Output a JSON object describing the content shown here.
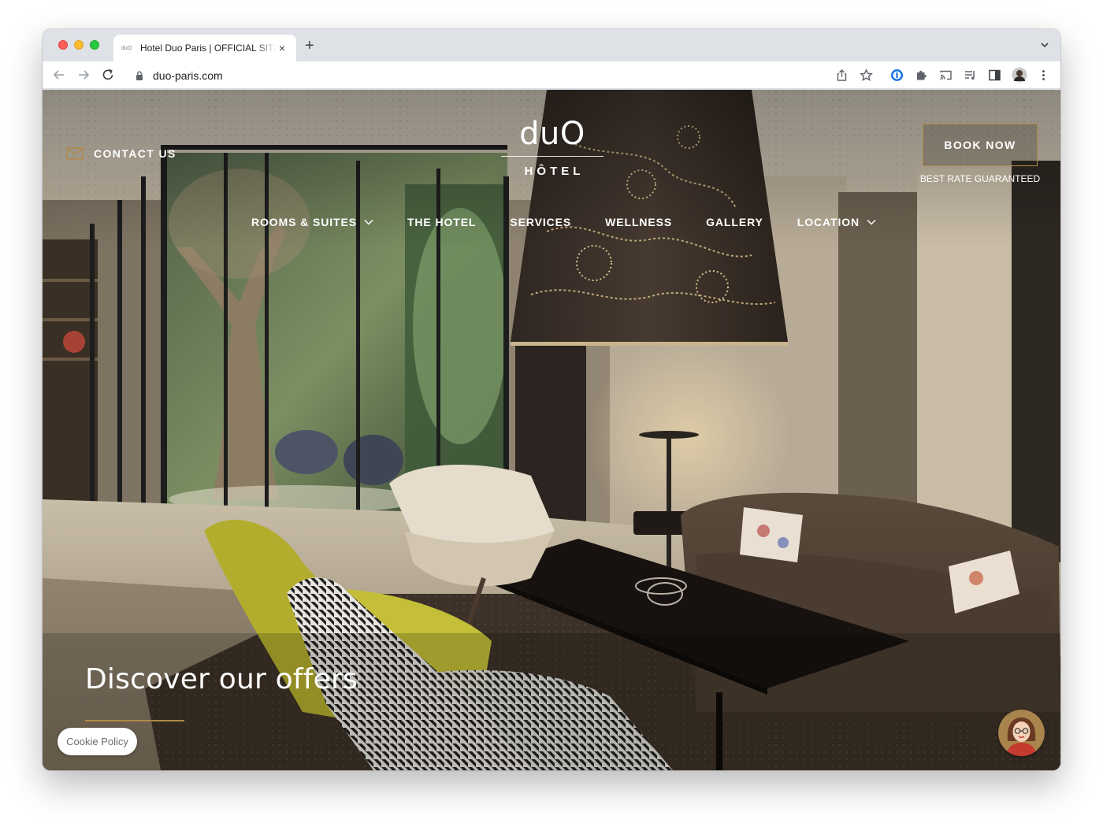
{
  "browser": {
    "tab": {
      "favicon_text": "duO",
      "title": "Hotel Duo Paris | OFFICIAL SITE",
      "close_glyph": "×"
    },
    "new_tab_glyph": "+",
    "omnibox": {
      "url": "duo-paris.com"
    },
    "toolbar_icons": [
      "back-icon",
      "forward-icon",
      "reload-icon",
      "lock-icon",
      "share-icon",
      "bookmark-star-icon",
      "extension-1password-icon",
      "extensions-puzzle-icon",
      "cast-icon",
      "reading-list-icon",
      "side-panel-icon",
      "profile-avatar-icon",
      "menu-kebab-icon"
    ]
  },
  "site": {
    "contact": {
      "label": "CONTACT US",
      "icon": "envelope-icon"
    },
    "logo": {
      "word": "duO",
      "sub": "HÔTEL"
    },
    "book": {
      "label": "BOOK NOW",
      "note": "BEST RATE GUARANTEED"
    },
    "nav": [
      {
        "label": "ROOMS & SUITES",
        "dropdown": true
      },
      {
        "label": "THE HOTEL",
        "dropdown": false
      },
      {
        "label": "SERVICES",
        "dropdown": false
      },
      {
        "label": "WELLNESS",
        "dropdown": false
      },
      {
        "label": "GALLERY",
        "dropdown": false
      },
      {
        "label": "LOCATION",
        "dropdown": true
      }
    ],
    "hero": {
      "headline": "Discover our offers"
    },
    "cookie": {
      "label": "Cookie Policy"
    },
    "chat_avatar": "assistant-avatar-icon"
  },
  "colors": {
    "accent_gold": "#b08a45",
    "text_white": "#ffffff",
    "chrome_bg": "#dee1e6"
  }
}
